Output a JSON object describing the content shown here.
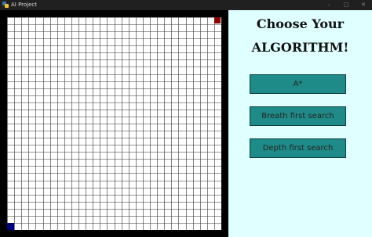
{
  "window": {
    "title": "AI Project",
    "controls": [
      "–",
      "□",
      "✕"
    ]
  },
  "grid": {
    "rows": 30,
    "cols": 30,
    "start": {
      "row": 29,
      "col": 0,
      "color": "#000080"
    },
    "end": {
      "row": 0,
      "col": 29,
      "color": "#8b0000"
    }
  },
  "panel": {
    "heading_line1": "Choose Your",
    "heading_line2": "ALGORITHM!",
    "buttons": [
      {
        "label": "A*"
      },
      {
        "label": "Breath first search"
      },
      {
        "label": "Depth first search"
      }
    ]
  },
  "colors": {
    "panel_bg": "#e0ffff",
    "button_bg": "#1f8b88",
    "grid_border": "#000000"
  }
}
